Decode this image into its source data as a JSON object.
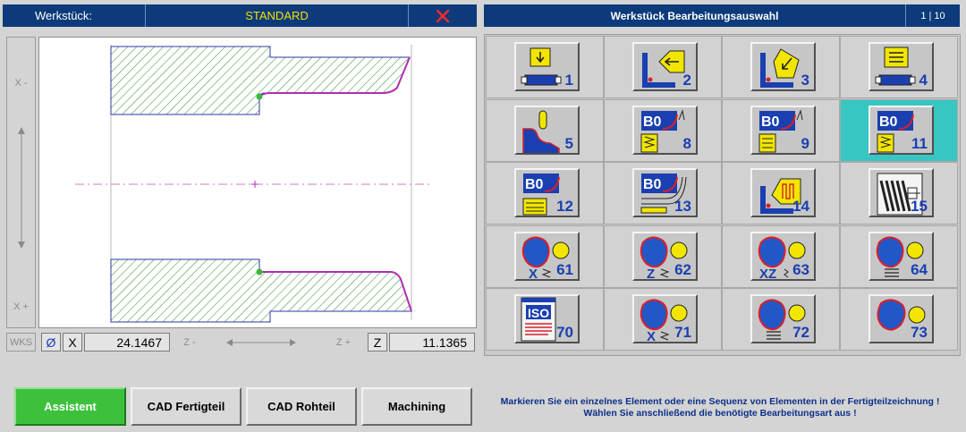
{
  "left_header": {
    "label": "Werkstück:",
    "program": "STANDARD",
    "close_icon": "red-x-icon"
  },
  "right_header": {
    "title": "Werkstück Bearbeitungsauswahl",
    "page": "1 | 10"
  },
  "drawing": {
    "x_minus": "X -",
    "x_plus": "X +",
    "coord_label": "WKS",
    "diameter_symbol": "Ø",
    "x_axis": "X",
    "x_value": "24.1467",
    "z_minus": "Z -",
    "z_plus": "Z +",
    "z_axis": "Z",
    "z_value": "11.1365"
  },
  "operations": [
    {
      "number": "1",
      "icon": "facing-icon",
      "selected": false
    },
    {
      "number": "2",
      "icon": "contour-plunge-inside-icon",
      "selected": false
    },
    {
      "number": "3",
      "icon": "contour-plunge-angle-icon",
      "selected": false
    },
    {
      "number": "4",
      "icon": "longitudinal-cycle-icon",
      "selected": false
    },
    {
      "number": "5",
      "icon": "contour-profile-icon",
      "selected": false
    },
    {
      "number": "8",
      "icon": "b0-zigzag-icon",
      "selected": false
    },
    {
      "number": "9",
      "icon": "b0-lines-icon",
      "selected": false
    },
    {
      "number": "11",
      "icon": "b0-zigzag-selected-icon",
      "selected": true
    },
    {
      "number": "12",
      "icon": "b0-stacked-icon",
      "selected": false
    },
    {
      "number": "13",
      "icon": "b0-finishing-icon",
      "selected": false
    },
    {
      "number": "14",
      "icon": "grooving-icon",
      "selected": false
    },
    {
      "number": "15",
      "icon": "thread-icon",
      "selected": false
    },
    {
      "number": "61",
      "icon": "pocket-x-icon",
      "sub": "X",
      "selected": false
    },
    {
      "number": "62",
      "icon": "pocket-z-icon",
      "sub": "Z",
      "selected": false
    },
    {
      "number": "63",
      "icon": "pocket-xz-icon",
      "sub": "XZ",
      "selected": false
    },
    {
      "number": "64",
      "icon": "pocket-lines-icon",
      "sub": "",
      "selected": false
    },
    {
      "number": "70",
      "icon": "iso-icon",
      "selected": false
    },
    {
      "number": "71",
      "icon": "pocket-x-finish-icon",
      "sub": "X",
      "selected": false
    },
    {
      "number": "72",
      "icon": "pocket-lines-finish-icon",
      "sub": "",
      "selected": false
    },
    {
      "number": "73",
      "icon": "pocket-circle-icon",
      "sub": "",
      "selected": false
    }
  ],
  "buttons": {
    "assistant": "Assistent",
    "cad_finished": "CAD Fertigteil",
    "cad_raw": "CAD Rohteil",
    "machining": "Machining"
  },
  "message": {
    "line1": "Markieren Sie ein einzelnes Element oder eine Sequenz von Elementen in der Fertigteilzeichnung !",
    "line2": "Wählen Sie anschließend die benötigte Bearbeitungsart aus !"
  },
  "colors": {
    "header_bg": "#0c3a7a",
    "program_text": "#f5e100",
    "selected_cell": "#38c6c3",
    "assistant_green": "#3dc13d",
    "number_blue": "#1a3fb0",
    "contour_magenta": "#b02eb0",
    "hatch_green": "#2e8a2e"
  }
}
